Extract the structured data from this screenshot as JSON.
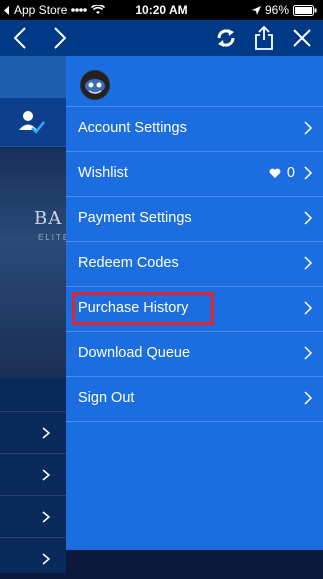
{
  "status": {
    "back_label": "App Store",
    "time": "10:20 AM",
    "battery": "96%"
  },
  "navbar": {
    "icons": [
      "back-arrow-icon",
      "forward-arrow-icon",
      "refresh-icon",
      "share-icon",
      "close-icon"
    ]
  },
  "background": {
    "game_title": "BA",
    "game_subtitle": "ELITE"
  },
  "menu": {
    "items": [
      {
        "label": "Account Settings"
      },
      {
        "label": "Wishlist",
        "count": "0"
      },
      {
        "label": "Payment Settings"
      },
      {
        "label": "Redeem Codes"
      },
      {
        "label": "Purchase History",
        "highlighted": true
      },
      {
        "label": "Download Queue"
      },
      {
        "label": "Sign Out"
      }
    ]
  },
  "colors": {
    "menu_bg": "#1c6ee0",
    "navbar_bg": "#003a87",
    "highlight": "#e4232a"
  }
}
